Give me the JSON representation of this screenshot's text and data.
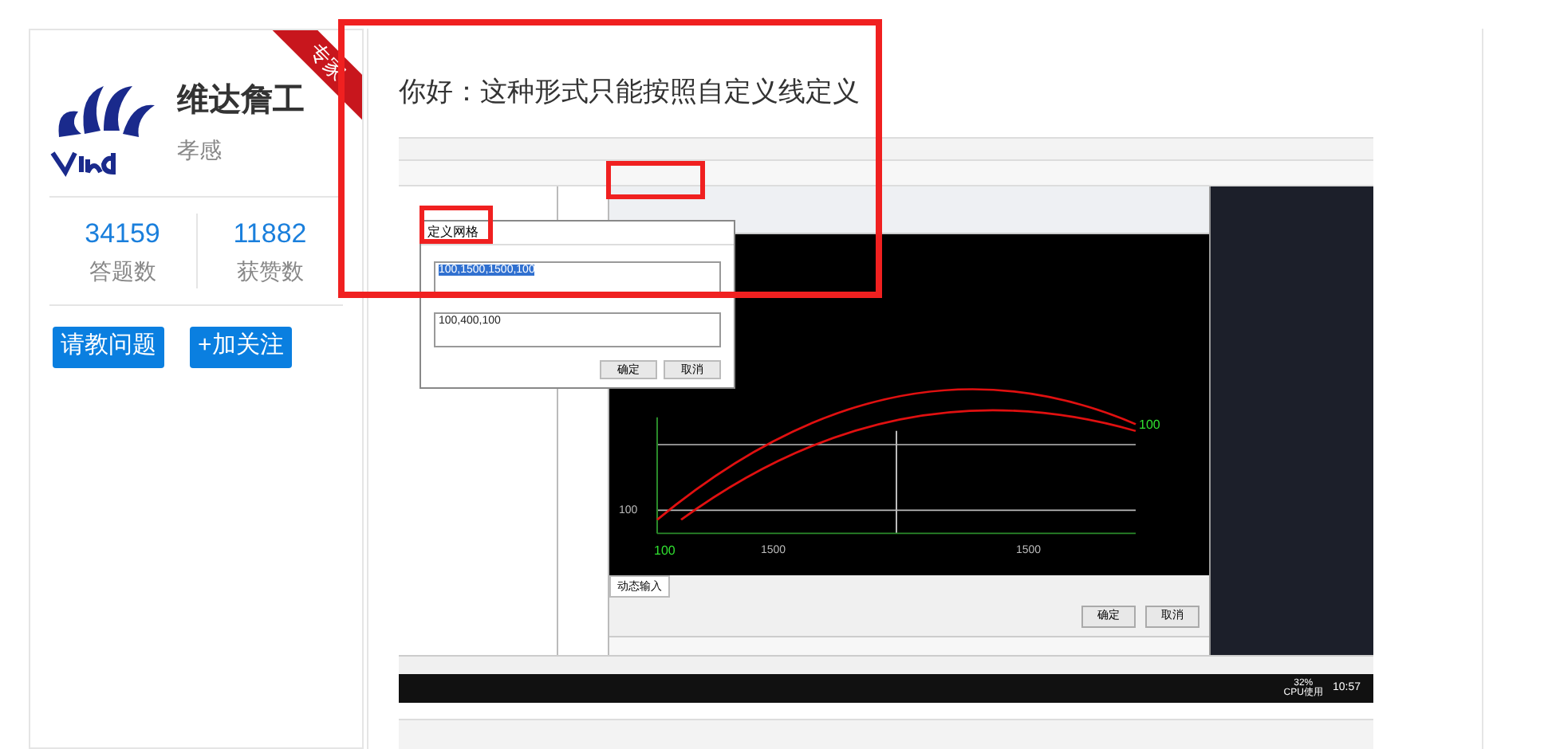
{
  "profile": {
    "badge": "专家",
    "name": "维达詹工",
    "location": "孝感",
    "stats": [
      {
        "value": "34159",
        "label": "答题数"
      },
      {
        "value": "11882",
        "label": "获赞数"
      }
    ],
    "buttons": [
      "请教问题",
      "+加关注"
    ]
  },
  "answer": {
    "text": "你好：这种形式只能按照自定义线定义",
    "screenshot": {
      "dialog": {
        "title": "定义网格",
        "fields": [
          "100,1500,1500,100",
          "100,400,100"
        ],
        "buttons": [
          "确定",
          "取消"
        ]
      },
      "canvas_labels": [
        "100",
        "100",
        "100",
        "1500",
        "1500"
      ],
      "tab": "动态输入",
      "buttons": [
        "确定",
        "取消"
      ],
      "taskbar": {
        "cpu": "32%",
        "cpu_label": "CPU使用",
        "time": "10:57"
      }
    }
  }
}
